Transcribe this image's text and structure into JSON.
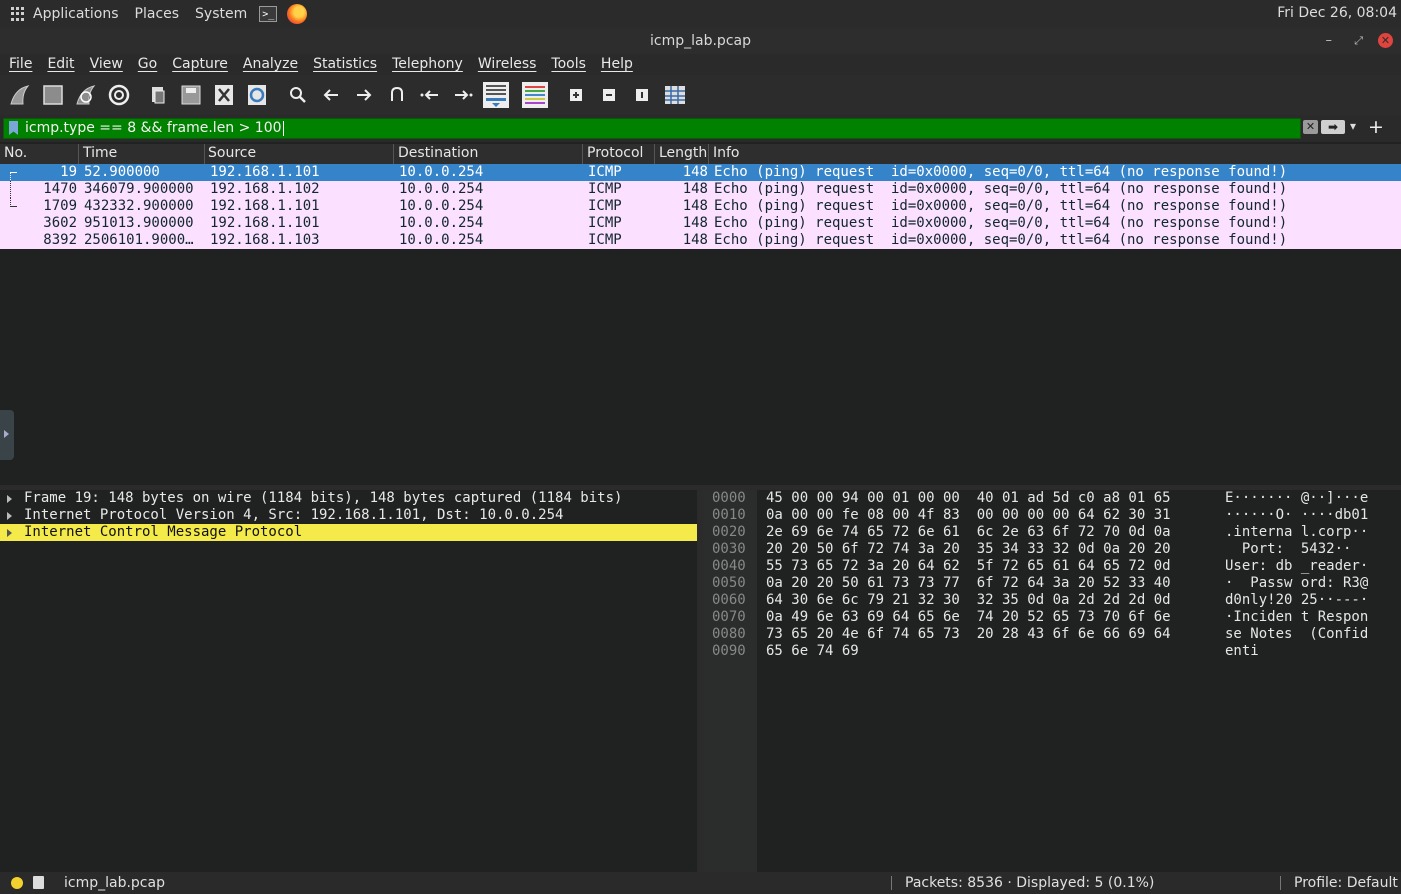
{
  "topbar": {
    "applications": "Applications",
    "places": "Places",
    "system": "System",
    "clock": "Fri Dec 26, 08:04"
  },
  "window": {
    "title": "icmp_lab.pcap",
    "minimize": "–",
    "maximize": "⤢",
    "close": "✕"
  },
  "menubar": [
    "File",
    "Edit",
    "View",
    "Go",
    "Capture",
    "Analyze",
    "Statistics",
    "Telephony",
    "Wireless",
    "Tools",
    "Help"
  ],
  "filter": {
    "value": "icmp.type == 8 && frame.len > 100",
    "clear": "✕",
    "apply": "➡",
    "dropdown": "▾",
    "add": "+"
  },
  "packet_list": {
    "columns": [
      "No.",
      "Time",
      "Source",
      "Destination",
      "Protocol",
      "Length",
      "Info"
    ],
    "rows": [
      {
        "no": "19",
        "time": "52.900000",
        "src": "192.168.1.101",
        "dst": "10.0.0.254",
        "proto": "ICMP",
        "len": "148",
        "info": "Echo (ping) request  id=0x0000, seq=0/0, ttl=64 (no response found!)"
      },
      {
        "no": "1470",
        "time": "346079.900000",
        "src": "192.168.1.102",
        "dst": "10.0.0.254",
        "proto": "ICMP",
        "len": "148",
        "info": "Echo (ping) request  id=0x0000, seq=0/0, ttl=64 (no response found!)"
      },
      {
        "no": "1709",
        "time": "432332.900000",
        "src": "192.168.1.101",
        "dst": "10.0.0.254",
        "proto": "ICMP",
        "len": "148",
        "info": "Echo (ping) request  id=0x0000, seq=0/0, ttl=64 (no response found!)"
      },
      {
        "no": "3602",
        "time": "951013.900000",
        "src": "192.168.1.101",
        "dst": "10.0.0.254",
        "proto": "ICMP",
        "len": "148",
        "info": "Echo (ping) request  id=0x0000, seq=0/0, ttl=64 (no response found!)"
      },
      {
        "no": "8392",
        "time": "2506101.9000…",
        "src": "192.168.1.103",
        "dst": "10.0.0.254",
        "proto": "ICMP",
        "len": "148",
        "info": "Echo (ping) request  id=0x0000, seq=0/0, ttl=64 (no response found!)"
      }
    ]
  },
  "details": [
    "Frame 19: 148 bytes on wire (1184 bits), 148 bytes captured (1184 bits)",
    "Internet Protocol Version 4, Src: 192.168.1.101, Dst: 10.0.0.254",
    "Internet Control Message Protocol"
  ],
  "bytes": [
    {
      "off": "0000",
      "hex": "45 00 00 94 00 01 00 00  40 01 ad 5d c0 a8 01 65",
      "asc": "E······· @··]···e"
    },
    {
      "off": "0010",
      "hex": "0a 00 00 fe 08 00 4f 83  00 00 00 00 64 62 30 31",
      "asc": "······O· ····db01"
    },
    {
      "off": "0020",
      "hex": "2e 69 6e 74 65 72 6e 61  6c 2e 63 6f 72 70 0d 0a",
      "asc": ".interna l.corp··"
    },
    {
      "off": "0030",
      "hex": "20 20 50 6f 72 74 3a 20  35 34 33 32 0d 0a 20 20",
      "asc": "  Port:  5432··  "
    },
    {
      "off": "0040",
      "hex": "55 73 65 72 3a 20 64 62  5f 72 65 61 64 65 72 0d",
      "asc": "User: db _reader·"
    },
    {
      "off": "0050",
      "hex": "0a 20 20 50 61 73 73 77  6f 72 64 3a 20 52 33 40",
      "asc": "·  Passw ord: R3@"
    },
    {
      "off": "0060",
      "hex": "64 30 6e 6c 79 21 32 30  32 35 0d 0a 2d 2d 2d 0d",
      "asc": "d0nly!20 25··---·"
    },
    {
      "off": "0070",
      "hex": "0a 49 6e 63 69 64 65 6e  74 20 52 65 73 70 6f 6e",
      "asc": "·Inciden t Respon"
    },
    {
      "off": "0080",
      "hex": "73 65 20 4e 6f 74 65 73  20 28 43 6f 6e 66 69 64",
      "asc": "se Notes  (Confid"
    },
    {
      "off": "0090",
      "hex": "65 6e 74 69",
      "asc": "enti"
    }
  ],
  "status": {
    "file": "icmp_lab.pcap",
    "packets": "Packets: 8536 · Displayed: 5 (0.1%)",
    "profile": "Profile: Default"
  },
  "colors": {
    "filter_valid": "#008100",
    "selected_row": "#3583c8",
    "icmp_row": "#fce0ff",
    "highlight": "#f4ea4a"
  }
}
